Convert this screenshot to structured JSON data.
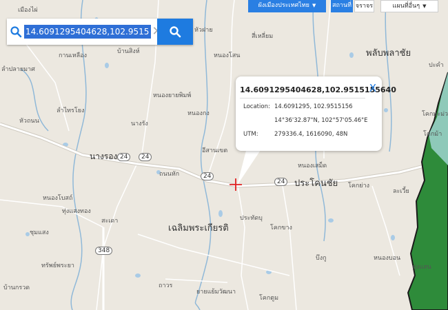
{
  "search": {
    "value": "14.6091295404628,102.9515155640"
  },
  "top_controls": {
    "layer_select": "ผังเมืองประเทศไทย",
    "tab_place": "สถานที่",
    "tab_traffic": "จราจร",
    "map_type_select": "แผนที่อื่นๆ"
  },
  "popup": {
    "title": "14.6091295404628,102.9515155640",
    "close": "X",
    "location_label": "Location:",
    "location_decimal": "14.6091295, 102.9515156",
    "location_dms": "14°36'32.87\"N, 102°57'05.46\"E",
    "utm_label": "UTM:",
    "utm_value": "279336.4, 1616090, 48N"
  },
  "map_labels": {
    "nang_rong": "นางรอง",
    "prakhon_chai": "ประโคนชัย",
    "chaloem_phra_kiat": "เฉลิมพระเกียรติ",
    "phlap_phla_chai": "พลับพลาชัย",
    "route_24_a": "24",
    "route_24_b": "24",
    "route_24_c": "24",
    "route_24_d": "24",
    "route_348": "348",
    "l1": "เมืองไผ่",
    "l2": "หนองโสน",
    "l3": "สี่เหลี่ยม",
    "l4": "กานเหลือง",
    "l5": "บ้านสิงห์",
    "l6": "ลำปลายมาศ",
    "l7": "หนองยายพิมพ์",
    "l8": "หนองกง",
    "l9": "ลำไทรโยง",
    "l10": "หัวถนน",
    "l11": "นางรัง",
    "l12": "อีสานเขต",
    "l13": "ถนนหัก",
    "l14": "หนองโบสถ์",
    "l15": "ทุ่งแสงทอง",
    "l16": "สะเดา",
    "l17": "ชุมแสง",
    "l18": "ทรัพย์พระยา",
    "l19": "ประทัดบุ",
    "l20": "โคกขาง",
    "l21": "โคกย่าง",
    "l22": "ละเวี้ย",
    "l23": "บึงกู",
    "l24": "หนองบอน",
    "l25": "ถาวร",
    "l26": "ยายแย้มวัฒนา",
    "l27": "โคกตูม",
    "l28": "หัวฝาย",
    "l29": "ปะคำ",
    "l30": "โคกมะม่วง",
    "l31": "โคกม้า",
    "l32": "หนองเสม็ด",
    "l33": "ทุ่งแสน",
    "l34": "บ้านกรวด"
  },
  "colors": {
    "search_button": "#1e7be0",
    "selected_text_bg": "#2f6fd6",
    "road": "#ffffff",
    "river": "#8fb8d8",
    "forest": "#2e8b3a",
    "marker": "#e02020"
  }
}
